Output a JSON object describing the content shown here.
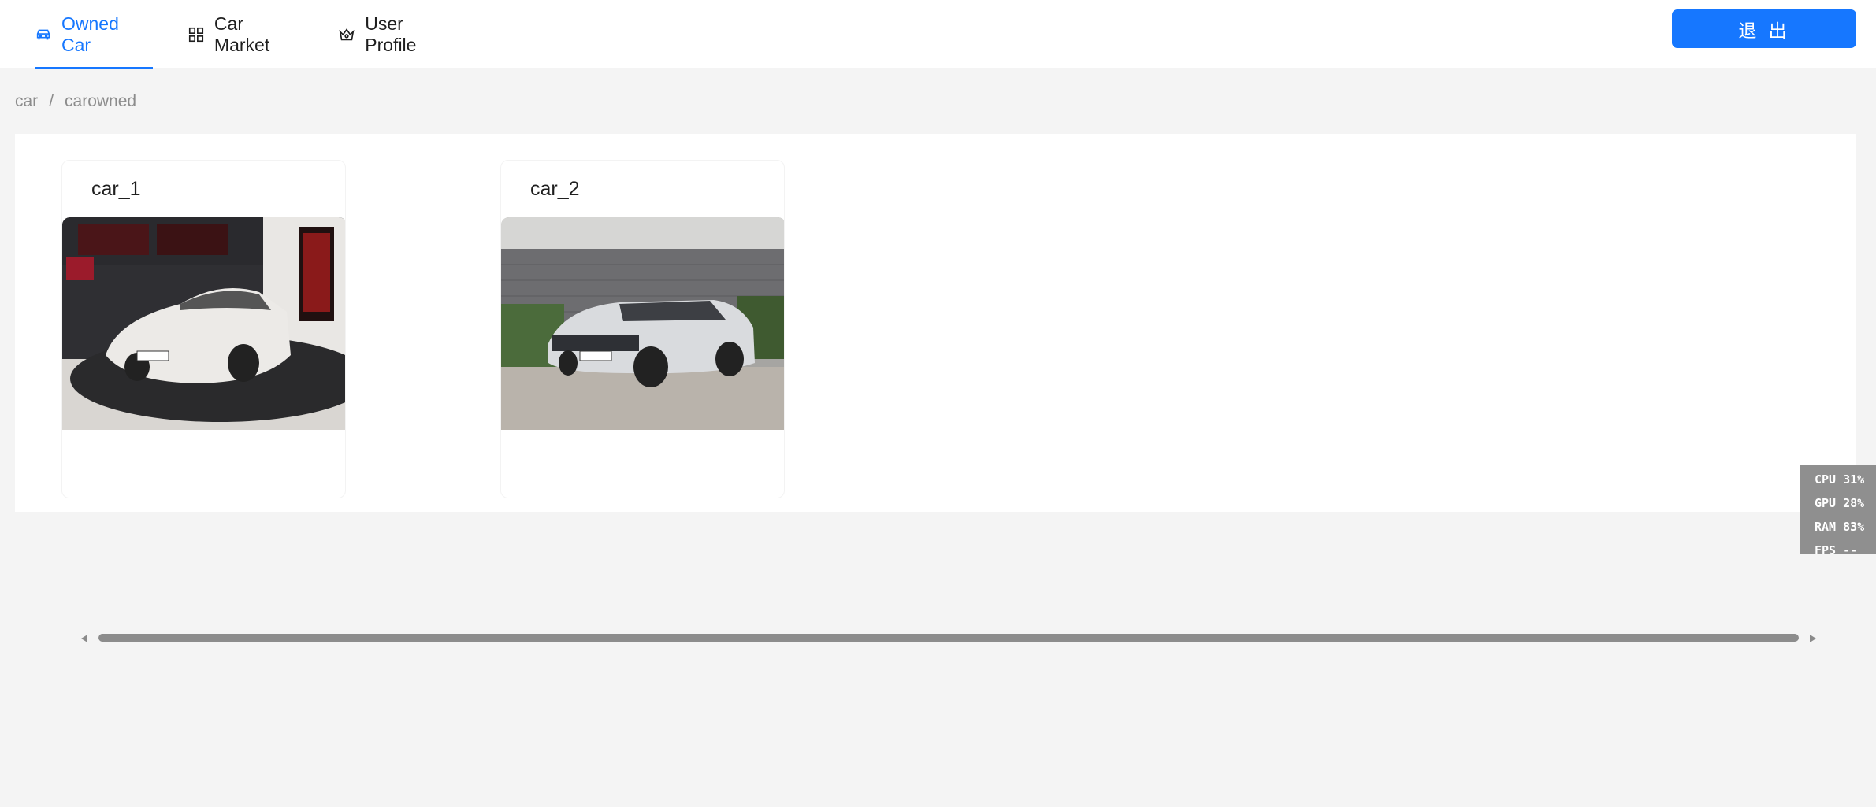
{
  "nav": {
    "items": [
      {
        "label": "Owned Car",
        "icon": "car-icon",
        "active": true
      },
      {
        "label": "Car Market",
        "icon": "appstore-icon",
        "active": false
      },
      {
        "label": "User Profile",
        "icon": "crown-icon",
        "active": false
      }
    ],
    "logout_label": "退 出"
  },
  "breadcrumb": {
    "items": [
      "car",
      "carowned"
    ],
    "separator": "/"
  },
  "cars": [
    {
      "name": "car_1"
    },
    {
      "name": "car_2"
    }
  ],
  "perf": {
    "cpu": "CPU  31%",
    "gpu": "GPU  28%",
    "ram": "RAM  83%",
    "fps": "FPS --"
  },
  "colors": {
    "primary": "#1677ff",
    "background": "#f4f4f4",
    "panel": "#ffffff"
  }
}
